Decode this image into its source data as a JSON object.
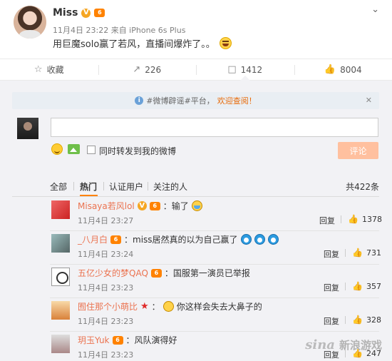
{
  "post": {
    "author": "Miss",
    "verified_badge": "V",
    "vip_badge": "6",
    "meta": "11月4日 23:22 来自 iPhone 6s Plus",
    "text": "用巨魔solo赢了若风，直播间爆炸了。。",
    "text_emoji": "laugh-emoji"
  },
  "actions": {
    "favorite": "收藏",
    "repost_count": "226",
    "comment_count": "1412",
    "like_count": "8004"
  },
  "comment_box": {
    "notice_prefix": "#微博辟谣#平台，",
    "notice_highlight": "欢迎查阅！",
    "repost_label": "同时转发到我的微博",
    "submit_label": "评论"
  },
  "filters": {
    "all": "全部",
    "hot": "热门",
    "verified": "认证用户",
    "following": "关注的人",
    "total": "共422条"
  },
  "comments": [
    {
      "user": "Misaya若风lol",
      "text": "：输了",
      "time": "11月4日 23:27",
      "reply": "回复",
      "likes": "1378",
      "vip": "6"
    },
    {
      "user": "_八月白",
      "text": "：miss居然真的以为自己赢了",
      "time": "11月4日 23:24",
      "reply": "回复",
      "likes": "731",
      "vip": "6"
    },
    {
      "user": "五亿少女的梦QAQ",
      "text": "：国服第一演员已举报",
      "time": "11月4日 23:23",
      "reply": "回复",
      "likes": "357",
      "vip": "6"
    },
    {
      "user": "囿住那个小萌比",
      "text": "你这样会失去大鼻子的",
      "time": "11月4日 23:23",
      "reply": "回复",
      "likes": "328",
      "vip": ""
    },
    {
      "user": "玥玉Yuk",
      "text": "：风队演得好",
      "time": "11月4日 23:23",
      "reply": "回复",
      "likes": "247",
      "vip": "6"
    }
  ],
  "watermark": {
    "logo": "sina",
    "text": "新浪游戏"
  }
}
